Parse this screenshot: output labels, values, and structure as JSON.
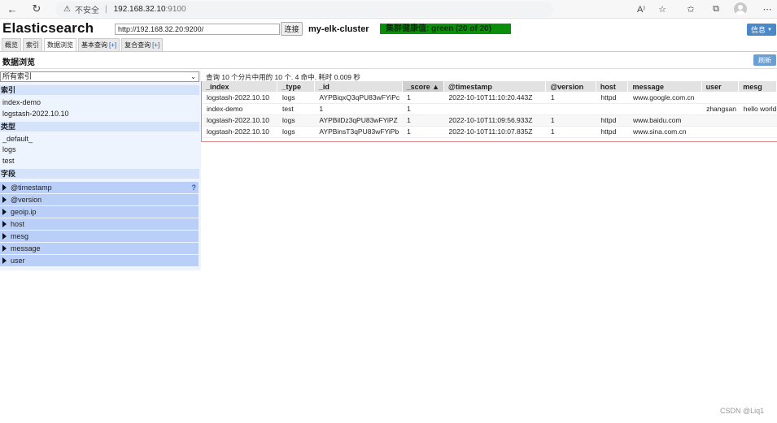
{
  "browser": {
    "insecure_label": "不安全",
    "url_host": "192.168.32.10",
    "url_port": ":9100"
  },
  "app": {
    "title": "Elasticsearch",
    "connect_url": "http://192.168.32.20:9200/",
    "connect_label": "连接",
    "cluster_name": "my-elk-cluster",
    "health": "集群健康值: green (20 of 20)",
    "info_label": "信息"
  },
  "tabs": [
    {
      "label": "概览",
      "plus": ""
    },
    {
      "label": "索引",
      "plus": ""
    },
    {
      "label": "数据浏览",
      "plus": ""
    },
    {
      "label": "基本查询",
      "plus": "[+]"
    },
    {
      "label": "复合查询",
      "plus": "[+]"
    }
  ],
  "browse": {
    "title": "数据浏览",
    "refresh_label": "刷新",
    "index_select": "所有索引",
    "sections": {
      "indices": "索引",
      "types": "类型",
      "fields": "字段"
    },
    "indices": [
      "index-demo",
      "logstash-2022.10.10"
    ],
    "types": [
      "_default_",
      "logs",
      "test"
    ],
    "fields": [
      "@timestamp",
      "@version",
      "geoip.ip",
      "host",
      "mesg",
      "message",
      "user"
    ],
    "help_mark": "?"
  },
  "results": {
    "summary": "查询 10 个分片中用的 10 个. 4 命中. 耗时 0.009 秒",
    "columns": [
      "_index",
      "_type",
      "_id",
      "_score ▲",
      "@timestamp",
      "@version",
      "host",
      "message",
      "user",
      "mesg"
    ],
    "rows": [
      [
        "logstash-2022.10.10",
        "logs",
        "AYPBiqxQ3qPU83wFYiPc",
        "1",
        "2022-10-10T11:10:20.443Z",
        "1",
        "httpd",
        "www.google.com.cn",
        "",
        ""
      ],
      [
        "index-demo",
        "test",
        "1",
        "1",
        "",
        "",
        "",
        "",
        "zhangsan",
        "hello world"
      ],
      [
        "logstash-2022.10.10",
        "logs",
        "AYPBilDz3qPU83wFYiPZ",
        "1",
        "2022-10-10T11:09:56.933Z",
        "1",
        "httpd",
        "www.baidu.com",
        "",
        ""
      ],
      [
        "logstash-2022.10.10",
        "logs",
        "AYPBinsT3qPU83wFYiPb",
        "1",
        "2022-10-10T11:10:07.835Z",
        "1",
        "httpd",
        "www.sina.com.cn",
        "",
        ""
      ]
    ]
  },
  "watermark": "CSDN @Liq1"
}
